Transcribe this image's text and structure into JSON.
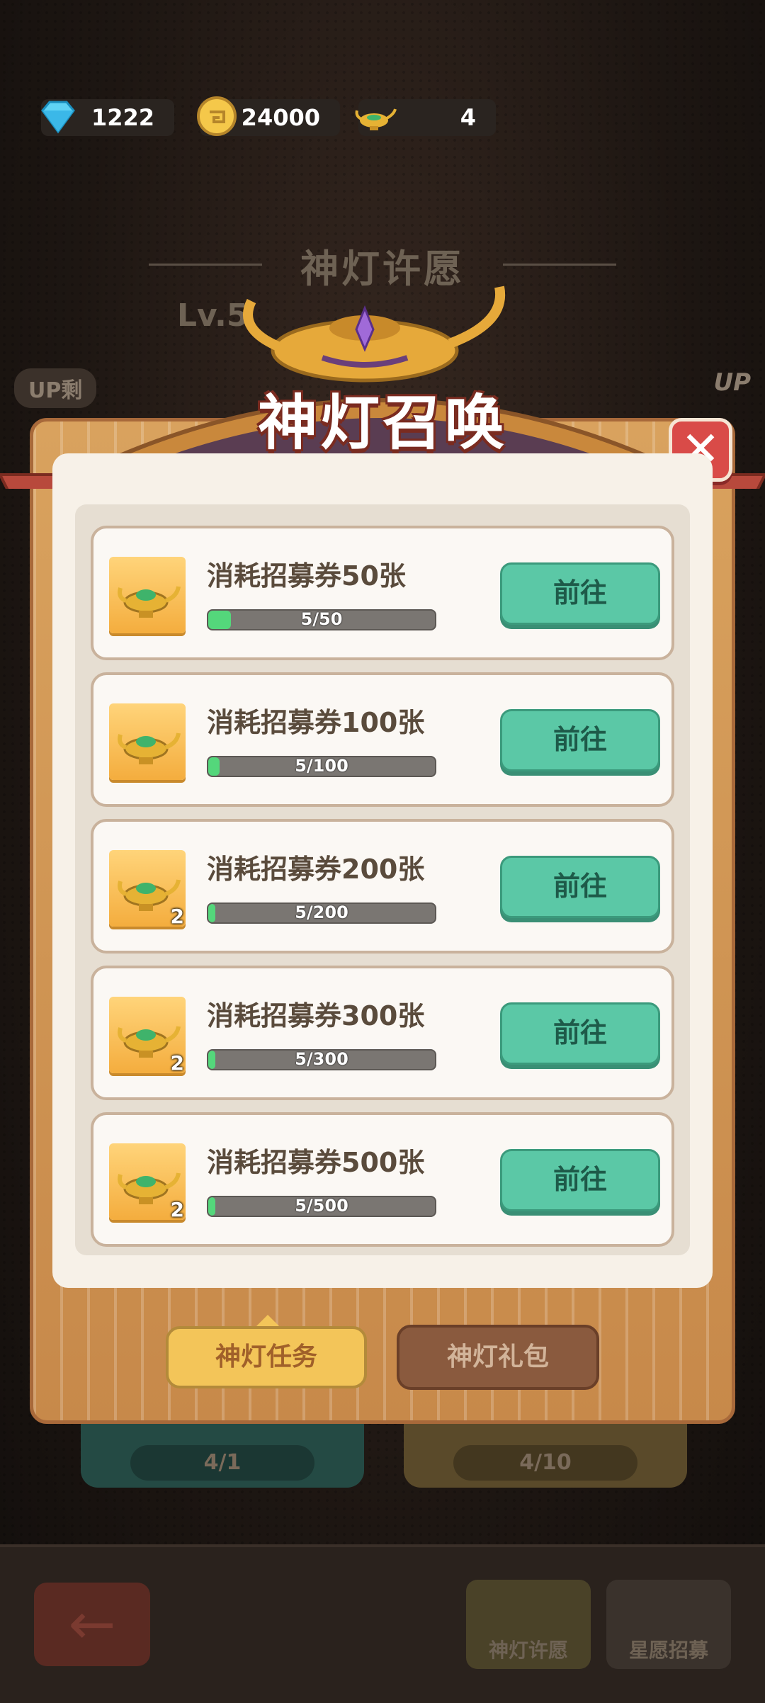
{
  "currency": {
    "gems": "1222",
    "coins": "24000",
    "lamps": "4"
  },
  "background": {
    "title": "神灯许愿",
    "level": "Lv.5",
    "up_label": "UP剩",
    "up_right": "UP",
    "bottom_left_count": "4/1",
    "bottom_right_count": "4/10",
    "nav_left": "神灯许愿",
    "nav_right": "星愿招募"
  },
  "modal": {
    "title": "神灯召唤",
    "close_label": "✕",
    "tasks": [
      {
        "title": "消耗招募券50张",
        "progress_text": "5/50",
        "progress": 0.1,
        "qty": "",
        "button": "前往"
      },
      {
        "title": "消耗招募券100张",
        "progress_text": "5/100",
        "progress": 0.05,
        "qty": "",
        "button": "前往"
      },
      {
        "title": "消耗招募券200张",
        "progress_text": "5/200",
        "progress": 0.025,
        "qty": "2",
        "button": "前往"
      },
      {
        "title": "消耗招募券300张",
        "progress_text": "5/300",
        "progress": 0.0167,
        "qty": "2",
        "button": "前往"
      },
      {
        "title": "消耗招募券500张",
        "progress_text": "5/500",
        "progress": 0.01,
        "qty": "2",
        "button": "前往"
      }
    ],
    "tab_tasks": "神灯任务",
    "tab_gift": "神灯礼包"
  }
}
